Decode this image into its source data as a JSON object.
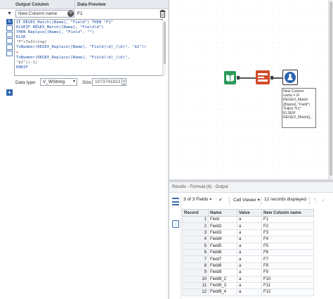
{
  "formula_panel": {
    "header_output_column": "Output Column",
    "header_data_preview": "Data Preview",
    "column_select_value": "New Column name",
    "preview_value": "F1",
    "expression_lines": [
      "IF REGEX_Match([Name], \"Field\") THEN \"F1\"",
      "ELSEIF REGEX_Match([Name], \"Field\\d\")",
      "THEN Replace([Name], \"Field\", \"\")",
      "ELSE",
      "\"F\"+ToString(",
      "ToNumber(REGEX_Replace([Name], \"Field(\\d)_(\\d)\", \"$1\"))",
      "+",
      "ToNumber(REGEX_Replace([Name], \"Field(\\d)_(\\d)\",",
      "\"$2\"))-1)",
      "ENDIF"
    ],
    "data_type_label": "Data type:",
    "data_type_value": "V_WString",
    "size_label": "Size:",
    "size_value": "1073741823"
  },
  "canvas": {
    "annotation_text": "New Column\nname = IF\nREGEX_Match\n([Name], \"Field\")\nTHEN \"F1\"\nELSEIF\nREGEX_Match([..."
  },
  "results": {
    "title": "Results - Formula (6) - Output",
    "fields_selector": "3 of 3 Fields",
    "viewer_selector": "Cell Viewer",
    "records_displayed": "12 records displayed",
    "columns": [
      "Record",
      "Name",
      "Value",
      "New Column name"
    ],
    "rows": [
      [
        "1",
        "Field",
        "a",
        "F1"
      ],
      [
        "2",
        "Field2",
        "a",
        "F2"
      ],
      [
        "3",
        "Field3",
        "a",
        "F3"
      ],
      [
        "4",
        "Field4",
        "a",
        "F4"
      ],
      [
        "5",
        "Field5",
        "a",
        "F5"
      ],
      [
        "6",
        "Field6",
        "a",
        "F6"
      ],
      [
        "7",
        "Field7",
        "a",
        "F7"
      ],
      [
        "8",
        "Field8",
        "a",
        "F8"
      ],
      [
        "9",
        "Field9",
        "a",
        "F9"
      ],
      [
        "10",
        "Field9_2",
        "a",
        "F10"
      ],
      [
        "11",
        "Field9_3",
        "a",
        "F11"
      ],
      [
        "12",
        "Field9_4",
        "a",
        "F12"
      ]
    ]
  },
  "colors": {
    "accent_blue": "#2d65b0",
    "input_tool_green": "#2b9a5a",
    "sample_tool_red": "#d04a2a"
  },
  "icons": [
    "chevron-down-icon",
    "clear-icon",
    "trash-icon",
    "formula-fx-icon",
    "add-icon",
    "book-input-icon",
    "sample-tool-icon",
    "formula-tool-icon",
    "table-view-icon",
    "cell-view-icon",
    "checkmark-icon",
    "arrow-up-icon",
    "arrow-down-icon"
  ]
}
